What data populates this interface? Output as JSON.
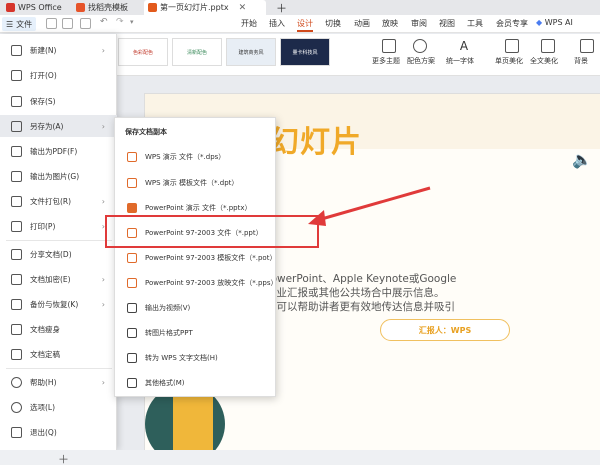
{
  "titlebar": {
    "tabs": [
      {
        "label": "WPS Office",
        "icon": "wps-logo-icon"
      },
      {
        "label": "找稻壳模板",
        "icon": "docer-icon"
      },
      {
        "label": "第一页幻灯片.pptx",
        "icon": "pptx-file-icon"
      }
    ]
  },
  "ribbon": {
    "file_label": "文件",
    "tabs": [
      "开始",
      "插入",
      "设计",
      "切换",
      "动画",
      "放映",
      "审阅",
      "视图",
      "工具",
      "会员专享"
    ],
    "active_tab": "设计",
    "wps_ai": "WPS AI"
  },
  "toolbar": {
    "templates": [
      "色彩配色",
      "清新配色",
      "建筑商务风",
      "量卡科技风"
    ],
    "buttons": [
      "更多主题",
      "配色方案",
      "统一字体",
      "单页美化",
      "全文美化",
      "背景"
    ]
  },
  "file_menu": {
    "items": [
      {
        "label": "新建(N)",
        "arrow": true,
        "icon": "new-icon"
      },
      {
        "label": "打开(O)",
        "arrow": false,
        "icon": "folder-icon"
      },
      {
        "label": "保存(S)",
        "arrow": false,
        "icon": "save-icon"
      },
      {
        "label": "另存为(A)",
        "arrow": true,
        "icon": "save-as-icon"
      },
      {
        "label": "输出为PDF(F)",
        "arrow": false,
        "icon": "pdf-icon"
      },
      {
        "label": "输出为图片(G)",
        "arrow": false,
        "icon": "image-icon"
      },
      {
        "label": "文件打包(R)",
        "arrow": true,
        "icon": "package-icon"
      },
      {
        "label": "打印(P)",
        "arrow": true,
        "icon": "print-icon"
      },
      {
        "label": "分享文档(D)",
        "arrow": false,
        "icon": "share-icon"
      },
      {
        "label": "文档加密(E)",
        "arrow": true,
        "icon": "lock-icon"
      },
      {
        "label": "备份与恢复(K)",
        "arrow": true,
        "icon": "backup-icon"
      },
      {
        "label": "文档瘦身",
        "arrow": false,
        "icon": "slim-icon"
      },
      {
        "label": "文档定稿",
        "arrow": false,
        "icon": "finalize-icon"
      },
      {
        "label": "帮助(H)",
        "arrow": true,
        "icon": "help-icon"
      },
      {
        "label": "选项(L)",
        "arrow": false,
        "icon": "settings-icon"
      },
      {
        "label": "退出(Q)",
        "arrow": false,
        "icon": "exit-icon"
      }
    ]
  },
  "submenu": {
    "title": "保存文档副本",
    "items": [
      {
        "label": "WPS 演示 文件（*.dps）",
        "icon": "dps-icon"
      },
      {
        "label": "WPS 演示 模板文件（*.dpt）",
        "icon": "dpt-icon"
      },
      {
        "label": "PowerPoint 演示 文件（*.pptx）",
        "icon": "pptx-icon"
      },
      {
        "label": "PowerPoint 97-2003 文件（*.ppt）",
        "icon": "ppt-icon"
      },
      {
        "label": "PowerPoint 97-2003 模板文件（*.pot）",
        "icon": "pot-icon"
      },
      {
        "label": "PowerPoint 97-2003 放映文件（*.pps）",
        "icon": "pps-icon"
      },
      {
        "label": "输出为视频(V)",
        "icon": "video-icon"
      },
      {
        "label": "转图片格式PPT",
        "icon": "image-ppt-icon"
      },
      {
        "label": "转为 WPS 文字文档(H)",
        "icon": "word-icon"
      },
      {
        "label": "其他格式(M)",
        "icon": "other-format-icon"
      }
    ]
  },
  "slide": {
    "title": "第一页幻灯片",
    "body_lines": [
      "的是使用软件如Microsoft PowerPoint、Apple Keynote或Google",
      "灯片用于在会议、研讨会、商业汇报或其他公共场合中展示信息。",
      "是一种强有力的沟通工具，它可以帮助讲者更有效地传达信息并吸引"
    ],
    "reporter": "汇报人：WPS"
  },
  "colors": {
    "accent": "#d04a1c",
    "title_color": "#f0a928",
    "highlight": "#e03a3a"
  }
}
